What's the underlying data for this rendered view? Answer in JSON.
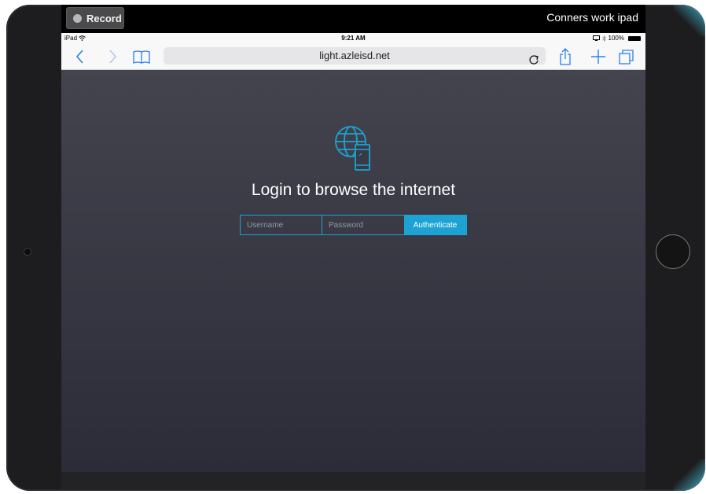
{
  "recorder": {
    "record_label": "Record",
    "device_name": "Conners work ipad"
  },
  "status_bar": {
    "device": "iPad",
    "time": "9:21 AM",
    "battery": "100%"
  },
  "browser": {
    "url": "light.azleisd.net"
  },
  "login": {
    "title": "Login to browse the internet",
    "username_placeholder": "Username",
    "password_placeholder": "Password",
    "authenticate_label": "Authenticate"
  },
  "colors": {
    "accent": "#1ca2d3",
    "page_top": "#464651",
    "page_bottom": "#2c2c38"
  },
  "icons": [
    "back-icon",
    "forward-icon",
    "bookmarks-icon",
    "reload-icon",
    "share-icon",
    "new-tab-icon",
    "tabs-icon",
    "wifi-icon",
    "bluetooth-icon",
    "battery-icon",
    "globe-phone-icon"
  ]
}
